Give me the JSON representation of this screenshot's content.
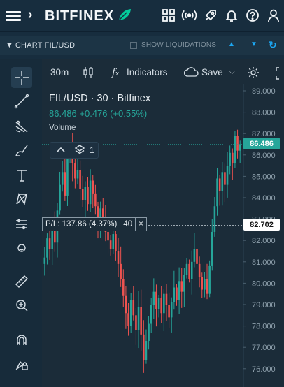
{
  "header": {
    "brand": "BITFINEX",
    "icons": [
      "menu-icon",
      "chevron-right-icon",
      "apps-grid-icon",
      "broadcast-icon",
      "rocket-icon",
      "bell-icon",
      "help-icon",
      "user-icon"
    ]
  },
  "subbar": {
    "title_prefix": "CHART",
    "pair": "FIL/USD",
    "show_liquidations": "SHOW LIQUIDATIONS"
  },
  "toolbar": {
    "interval": "30m",
    "indicators": "Indicators",
    "save": "Save"
  },
  "legend": {
    "pair": "FIL/USD",
    "interval": "30",
    "exchange": "Bitfinex",
    "last": "86.486",
    "change": "+0.476 (+0.55%)",
    "volume_label": "Volume"
  },
  "controls": {
    "layers_count": "1"
  },
  "position": {
    "pl": "P/L: 137.86 (4.37%)",
    "amount": "40",
    "close": "×"
  },
  "price_tags": {
    "last": "86.486",
    "position": "82.702"
  },
  "colors": {
    "up": "#26a69a",
    "down": "#ef5350",
    "accent": "#1ca7f2",
    "brand_leaf": "#03ca9b"
  },
  "chart_data": {
    "type": "candlestick",
    "ylim": [
      75.6,
      89.2
    ],
    "y_ticks": [
      "89.000",
      "88.000",
      "87.000",
      "86.000",
      "85.000",
      "84.000",
      "83.000",
      "82.000",
      "81.000",
      "80.000",
      "79.000",
      "78.000",
      "77.000",
      "76.000"
    ],
    "last_price": 86.486,
    "position_price": 82.702,
    "closes": [
      81.2,
      82.1,
      81.6,
      82.8,
      81.9,
      83.4,
      84.6,
      85.2,
      84.1,
      85.8,
      86.2,
      85.6,
      84.9,
      85.3,
      84.4,
      83.9,
      84.5,
      83.7,
      84.8,
      84.2,
      83.6,
      82.9,
      83.5,
      83.1,
      82.4,
      82.0,
      81.6,
      82.3,
      81.5,
      80.9,
      80.2,
      79.4,
      78.6,
      78.0,
      79.2,
      78.5,
      77.8,
      78.9,
      77.6,
      76.4,
      77.3,
      78.1,
      79.0,
      79.6,
      78.8,
      79.3,
      78.6,
      79.5,
      79.0,
      78.4,
      79.1,
      79.8,
      79.2,
      80.1,
      79.6,
      80.4,
      80.9,
      80.2,
      81.0,
      81.6,
      80.9,
      80.3,
      79.7,
      80.2,
      79.5,
      80.8,
      82.4,
      83.6,
      84.9,
      84.3,
      85.2,
      84.6,
      85.5,
      86.1,
      85.6,
      86.9,
      86.2,
      86.5
    ]
  }
}
